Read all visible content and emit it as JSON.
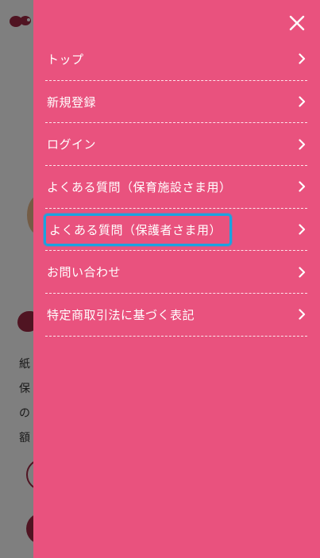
{
  "background": {
    "chars": [
      "紙",
      "保",
      "の",
      "額"
    ]
  },
  "drawer": {
    "close_label": "close",
    "items": [
      {
        "label": "トップ"
      },
      {
        "label": "新規登録"
      },
      {
        "label": "ログイン"
      },
      {
        "label": "よくある質問（保育施設さま用）"
      },
      {
        "label": "よくある質問（保護者さま用）",
        "focused": true
      },
      {
        "label": "お問い合わせ"
      },
      {
        "label": "特定商取引法に基づく表記"
      }
    ]
  },
  "colors": {
    "drawer_bg": "#e9527e",
    "focus_ring": "#1aa3e0",
    "brand_dark": "#a02845"
  }
}
